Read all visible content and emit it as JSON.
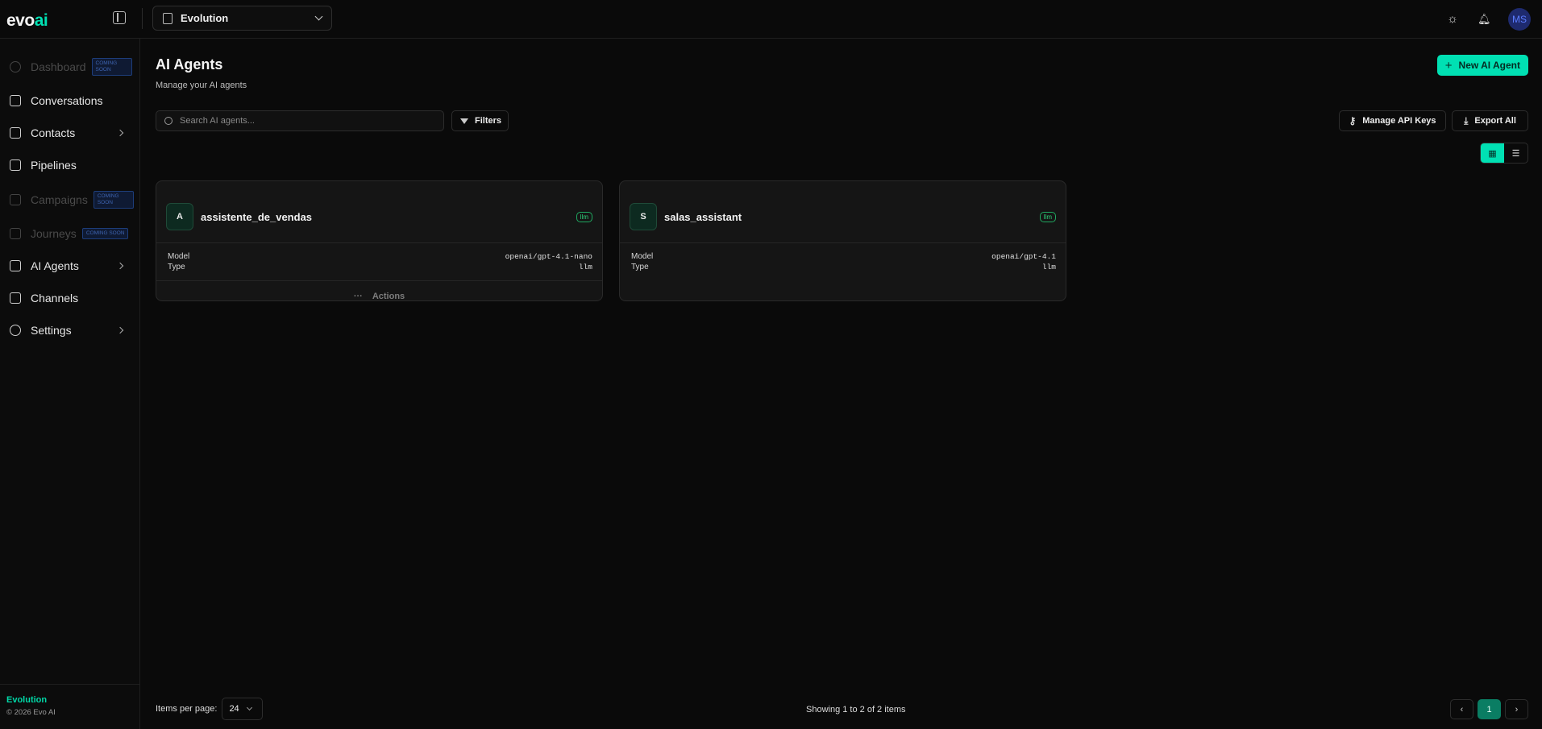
{
  "header": {
    "logo": {
      "evo": "evo",
      "ai": "ai"
    },
    "workspace": "Evolution",
    "avatar_initials": "MS",
    "accent_color": "#00e0b3"
  },
  "sidebar": {
    "items": [
      {
        "label": "Dashboard",
        "icon": "pie-chart-icon",
        "disabled": true,
        "badge": "COMING SOON"
      },
      {
        "label": "Conversations",
        "icon": "message-square-icon",
        "disabled": false
      },
      {
        "label": "Contacts",
        "icon": "contact-icon",
        "disabled": false,
        "expandable": true
      },
      {
        "label": "Pipelines",
        "icon": "kanban-icon",
        "disabled": false
      },
      {
        "label": "Campaigns",
        "icon": "megaphone-icon",
        "disabled": true,
        "badge": "COMING SOON"
      },
      {
        "label": "Journeys",
        "icon": "route-icon",
        "disabled": true,
        "badge": "COMING SOON"
      },
      {
        "label": "AI Agents",
        "icon": "bot-icon",
        "disabled": false,
        "expandable": true
      },
      {
        "label": "Channels",
        "icon": "layers-icon",
        "disabled": false
      },
      {
        "label": "Settings",
        "icon": "gear-icon",
        "disabled": false,
        "expandable": true
      }
    ],
    "footer": {
      "workspace": "Evolution",
      "copyright": "© 2026 Evo AI"
    }
  },
  "main": {
    "title": "AI Agents",
    "subtitle": "Manage your AI agents",
    "new_button": "New AI Agent",
    "search_placeholder": "Search AI agents...",
    "filters_label": "Filters",
    "api_keys_label": "Manage API Keys",
    "export_label": "Export All",
    "view_mode": "grid",
    "agents": [
      {
        "initial": "A",
        "name": "assistente_de_vendas",
        "badge": "llm",
        "model_label": "Model",
        "model": "openai/gpt-4.1-nano",
        "type_label": "Type",
        "type": "llm",
        "actions": "Actions"
      },
      {
        "initial": "S",
        "name": "salas_assistant",
        "badge": "llm",
        "model_label": "Model",
        "model": "openai/gpt-4.1",
        "type_label": "Type",
        "type": "llm"
      }
    ]
  },
  "pagination": {
    "items_per_page_label": "Items per page:",
    "items_per_page": "24",
    "showing": "Showing 1 to 2 of 2 items",
    "current_page": "1"
  }
}
